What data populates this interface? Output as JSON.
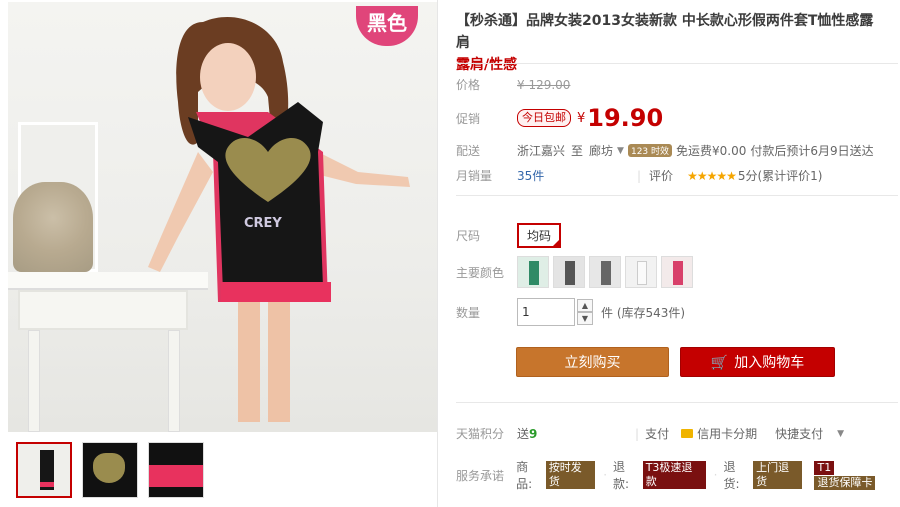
{
  "product": {
    "title_prefix": "【秒杀通】",
    "title_main": "品牌女装2013女装新款 中长款心形假两件套T恤性感露肩",
    "title_red": "露肩/性感",
    "badge_text": "黑色"
  },
  "pricing": {
    "original_label": "价格",
    "original_price": "¥ 129.00",
    "promo_label": "促销",
    "promo_tag": "今日包邮",
    "currency": "¥",
    "price": "19.90"
  },
  "shipping": {
    "label": "配送",
    "from": "浙江嘉兴",
    "to_word": "至",
    "to": "廊坊",
    "tag": "123 时效",
    "fee": "免运费¥0.00",
    "eta": "付款后预计6月9日送达"
  },
  "sales": {
    "label": "月销量",
    "count": "35件",
    "rating_label": "评价",
    "stars": "★★★★★",
    "rating_text": "5分(累计评价1)"
  },
  "options": {
    "size_label": "尺码",
    "size_value": "均码",
    "color_label": "主要颜色",
    "colors": [
      "green",
      "gray",
      "pink",
      "white",
      "red"
    ],
    "qty_label": "数量",
    "qty_value": "1",
    "stock_text": "件 (库存543件)"
  },
  "actions": {
    "buy_now": "立刻购买",
    "add_cart": "加入购物车"
  },
  "bottom": {
    "points_label": "天猫积分",
    "points_prefix": "送",
    "points_value": "9",
    "pay_label": "支付",
    "installment": "信用卡分期",
    "quick_pay": "快捷支付",
    "promise_label": "服务承诺",
    "goods_label": "商品:",
    "goods_tag": "按时发货",
    "refund_label": "退款:",
    "refund_tag": "T3极速退款",
    "return_label": "退货:",
    "return_tag": "上门退货",
    "t1_tag": "T1",
    "t1_text": "退货保障卡"
  },
  "colors_theme": {
    "brand_red": "#c40000",
    "buy_orange": "#c7752c"
  }
}
